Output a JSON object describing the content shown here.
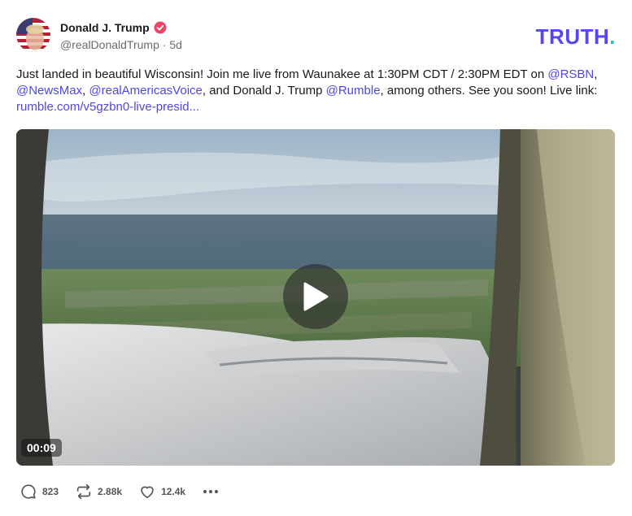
{
  "author": {
    "name": "Donald J. Trump",
    "handle": "@realDonaldTrump",
    "separator": "·",
    "age": "5d",
    "verified": true
  },
  "brand": {
    "logo_text": "TRUTH",
    "logo_dot": ".",
    "accent_color": "#5448ee",
    "dot_color": "#21c6b7"
  },
  "post": {
    "segments": [
      {
        "text": "Just landed in beautiful Wisconsin! Join me live from Waunakee at 1:30PM CDT / 2:30PM EDT on ",
        "type": "text"
      },
      {
        "text": "@RSBN",
        "type": "mention"
      },
      {
        "text": ", ",
        "type": "text"
      },
      {
        "text": "@NewsMax",
        "type": "mention"
      },
      {
        "text": ", ",
        "type": "text"
      },
      {
        "text": "@realAmericasVoice",
        "type": "mention"
      },
      {
        "text": ", and Donald J. Trump ",
        "type": "text"
      },
      {
        "text": "@Rumble",
        "type": "mention"
      },
      {
        "text": ", among others. See you soon! Live link: ",
        "type": "text"
      },
      {
        "text": "rumble.com/v5gzbn0-live-presid...",
        "type": "link"
      }
    ],
    "link_color": "#4f46e5"
  },
  "media": {
    "type": "video",
    "duration": "00:09"
  },
  "actions": {
    "replies": "823",
    "reposts": "2.88k",
    "likes": "12.4k",
    "icons": [
      "reply-icon",
      "repost-icon",
      "heart-icon",
      "more-icon"
    ]
  }
}
